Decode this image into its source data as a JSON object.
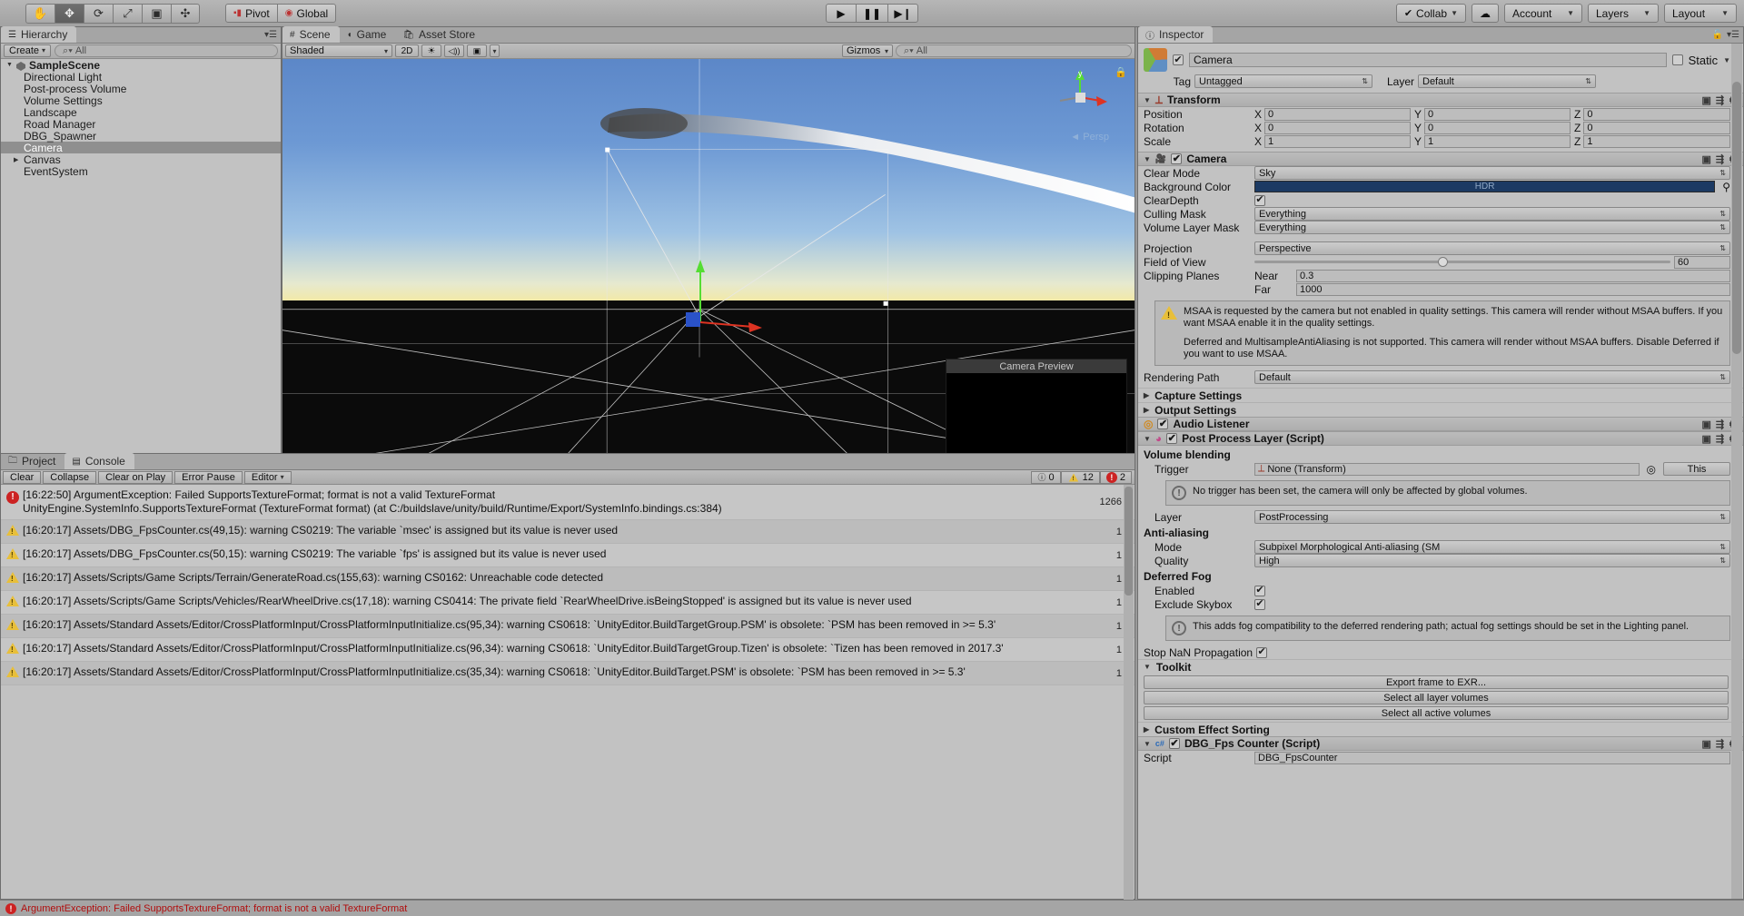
{
  "toolbar": {
    "tools": [
      {
        "name": "hand-tool",
        "glyph": "✋",
        "active": false
      },
      {
        "name": "move-tool",
        "glyph": "✥",
        "active": true
      },
      {
        "name": "rotate-tool",
        "glyph": "⟳",
        "active": false
      },
      {
        "name": "scale-tool",
        "glyph": "⤢",
        "active": false
      },
      {
        "name": "rect-tool",
        "glyph": "▣",
        "active": false
      },
      {
        "name": "transform-tool",
        "glyph": "✣",
        "active": false
      }
    ],
    "pivot_label": "Pivot",
    "global_label": "Global",
    "play_label": "▶",
    "pause_label": "❚❚",
    "step_label": "▶❙",
    "collab_label": "Collab",
    "cloud_label": "☁",
    "account_label": "Account",
    "layers_label": "Layers",
    "layout_label": "Layout"
  },
  "hierarchy": {
    "tab_label": "Hierarchy",
    "create_label": "Create",
    "search_placeholder": "All",
    "scene_name": "SampleScene",
    "items": [
      {
        "label": "Directional Light",
        "expandable": false,
        "selected": false
      },
      {
        "label": "Post-process Volume",
        "expandable": false,
        "selected": false
      },
      {
        "label": "Volume Settings",
        "expandable": false,
        "selected": false
      },
      {
        "label": "Landscape",
        "expandable": false,
        "selected": false
      },
      {
        "label": "Road Manager",
        "expandable": false,
        "selected": false
      },
      {
        "label": "DBG_Spawner",
        "expandable": false,
        "selected": false
      },
      {
        "label": "Camera",
        "expandable": false,
        "selected": true
      },
      {
        "label": "Canvas",
        "expandable": true,
        "selected": false
      },
      {
        "label": "EventSystem",
        "expandable": false,
        "selected": false
      }
    ]
  },
  "scene": {
    "tabs": [
      {
        "label": "Scene",
        "active": true,
        "icon": "grid-icon"
      },
      {
        "label": "Game",
        "active": false,
        "icon": "gamepad-icon"
      },
      {
        "label": "Asset Store",
        "active": false,
        "icon": "store-icon"
      }
    ],
    "shading_label": "Shaded",
    "mode_2d_label": "2D",
    "lighting_icon": "☀",
    "audio_icon": "◁))",
    "fx_icon": "▣",
    "gizmos_label": "Gizmos",
    "search_placeholder": "All",
    "persp_label": "Persp",
    "gizmo_axis_y": "y",
    "camera_preview_title": "Camera Preview"
  },
  "console": {
    "tabs": [
      {
        "label": "Project",
        "active": false,
        "icon": "folder-icon"
      },
      {
        "label": "Console",
        "active": true,
        "icon": "console-icon"
      }
    ],
    "buttons": [
      "Clear",
      "Collapse",
      "Clear on Play",
      "Error Pause",
      "Editor"
    ],
    "counts": {
      "info": "0",
      "warning": "12",
      "error": "2"
    },
    "rows": [
      {
        "type": "error",
        "text": "[16:22:50] ArgumentException: Failed SupportsTextureFormat; format is not a valid TextureFormat",
        "text2": "UnityEngine.SystemInfo.SupportsTextureFormat (TextureFormat format) (at C:/buildslave/unity/build/Runtime/Export/SystemInfo.bindings.cs:384)",
        "badge": "1266"
      },
      {
        "type": "warning",
        "text": "[16:20:17] Assets/DBG_FpsCounter.cs(49,15): warning CS0219: The variable `msec' is assigned but its value is never used",
        "text2": "",
        "badge": "1"
      },
      {
        "type": "warning",
        "text": "[16:20:17] Assets/DBG_FpsCounter.cs(50,15): warning CS0219: The variable `fps' is assigned but its value is never used",
        "text2": "",
        "badge": "1"
      },
      {
        "type": "warning",
        "text": "[16:20:17] Assets/Scripts/Game Scripts/Terrain/GenerateRoad.cs(155,63): warning CS0162: Unreachable code detected",
        "text2": "",
        "badge": "1"
      },
      {
        "type": "warning",
        "text": "[16:20:17] Assets/Scripts/Game Scripts/Vehicles/RearWheelDrive.cs(17,18): warning CS0414: The private field `RearWheelDrive.isBeingStopped' is assigned but its value is never used",
        "text2": "",
        "badge": "1"
      },
      {
        "type": "warning",
        "text": "[16:20:17] Assets/Standard Assets/Editor/CrossPlatformInput/CrossPlatformInputInitialize.cs(95,34): warning CS0618: `UnityEditor.BuildTargetGroup.PSM' is obsolete: `PSM has been removed in >= 5.3'",
        "text2": "",
        "badge": "1"
      },
      {
        "type": "warning",
        "text": "[16:20:17] Assets/Standard Assets/Editor/CrossPlatformInput/CrossPlatformInputInitialize.cs(96,34): warning CS0618: `UnityEditor.BuildTargetGroup.Tizen' is obsolete: `Tizen has been removed in 2017.3'",
        "text2": "",
        "badge": "1"
      },
      {
        "type": "warning",
        "text": "[16:20:17] Assets/Standard Assets/Editor/CrossPlatformInput/CrossPlatformInputInitialize.cs(35,34): warning CS0618: `UnityEditor.BuildTarget.PSM' is obsolete: `PSM has been removed in >= 5.3'",
        "text2": "",
        "badge": "1"
      }
    ]
  },
  "inspector": {
    "tab_label": "Inspector",
    "object_name": "Camera",
    "object_enabled": true,
    "static_label": "Static",
    "tag_label": "Tag",
    "tag_value": "Untagged",
    "layer_label": "Layer",
    "layer_value": "Default",
    "transform": {
      "title": "Transform",
      "rows": [
        {
          "label": "Position",
          "x": "0",
          "y": "0",
          "z": "0"
        },
        {
          "label": "Rotation",
          "x": "0",
          "y": "0",
          "z": "0"
        },
        {
          "label": "Scale",
          "x": "1",
          "y": "1",
          "z": "1"
        }
      ]
    },
    "camera": {
      "title": "Camera",
      "clear_mode_label": "Clear Mode",
      "clear_mode_value": "Sky",
      "background_color_label": "Background Color",
      "background_color_value": "HDR",
      "background_color_hex": "#1c3a63",
      "clear_depth_label": "ClearDepth",
      "culling_mask_label": "Culling Mask",
      "culling_mask_value": "Everything",
      "volume_layer_mask_label": "Volume Layer Mask",
      "volume_layer_mask_value": "Everything",
      "projection_label": "Projection",
      "projection_value": "Perspective",
      "fov_label": "Field of View",
      "fov_value": "60",
      "clipping_label": "Clipping Planes",
      "near_label": "Near",
      "near_value": "0.3",
      "far_label": "Far",
      "far_value": "1000",
      "warning_1": "MSAA is requested by the camera but not enabled in quality settings. This camera will render without MSAA buffers. If you want MSAA enable it in the quality settings.",
      "warning_2": "Deferred and MultisampleAntiAliasing is not supported. This camera will render without MSAA buffers. Disable Deferred if you want to use MSAA.",
      "rendering_path_label": "Rendering Path",
      "rendering_path_value": "Default",
      "capture_settings_label": "Capture Settings",
      "output_settings_label": "Output Settings"
    },
    "audio_listener": {
      "title": "Audio Listener"
    },
    "post_process_layer": {
      "title": "Post Process Layer (Script)",
      "volume_blending_label": "Volume blending",
      "trigger_label": "Trigger",
      "trigger_value": "None (Transform)",
      "this_label": "This",
      "trigger_info": "No trigger has been set, the camera will only be affected by global volumes.",
      "layer_label": "Layer",
      "layer_value": "PostProcessing",
      "antialiasing_label": "Anti-aliasing",
      "mode_label": "Mode",
      "mode_value": "Subpixel Morphological Anti-aliasing (SM",
      "quality_label": "Quality",
      "quality_value": "High",
      "deferred_fog_label": "Deferred Fog",
      "enabled_label": "Enabled",
      "exclude_skybox_label": "Exclude Skybox",
      "fog_info": "This adds fog compatibility to the deferred rendering path; actual fog settings should be set in the Lighting panel.",
      "stop_nan_label": "Stop NaN Propagation",
      "toolkit_label": "Toolkit",
      "export_label": "Export frame to EXR...",
      "select_layer_label": "Select all layer volumes",
      "select_active_label": "Select all active volumes",
      "custom_effect_label": "Custom Effect Sorting"
    },
    "dbg_fps": {
      "title": "DBG_Fps Counter (Script)",
      "script_label": "Script",
      "script_value": "DBG_FpsCounter"
    }
  },
  "statusbar": {
    "message": "ArgumentException: Failed SupportsTextureFormat; format is not a valid TextureFormat"
  }
}
